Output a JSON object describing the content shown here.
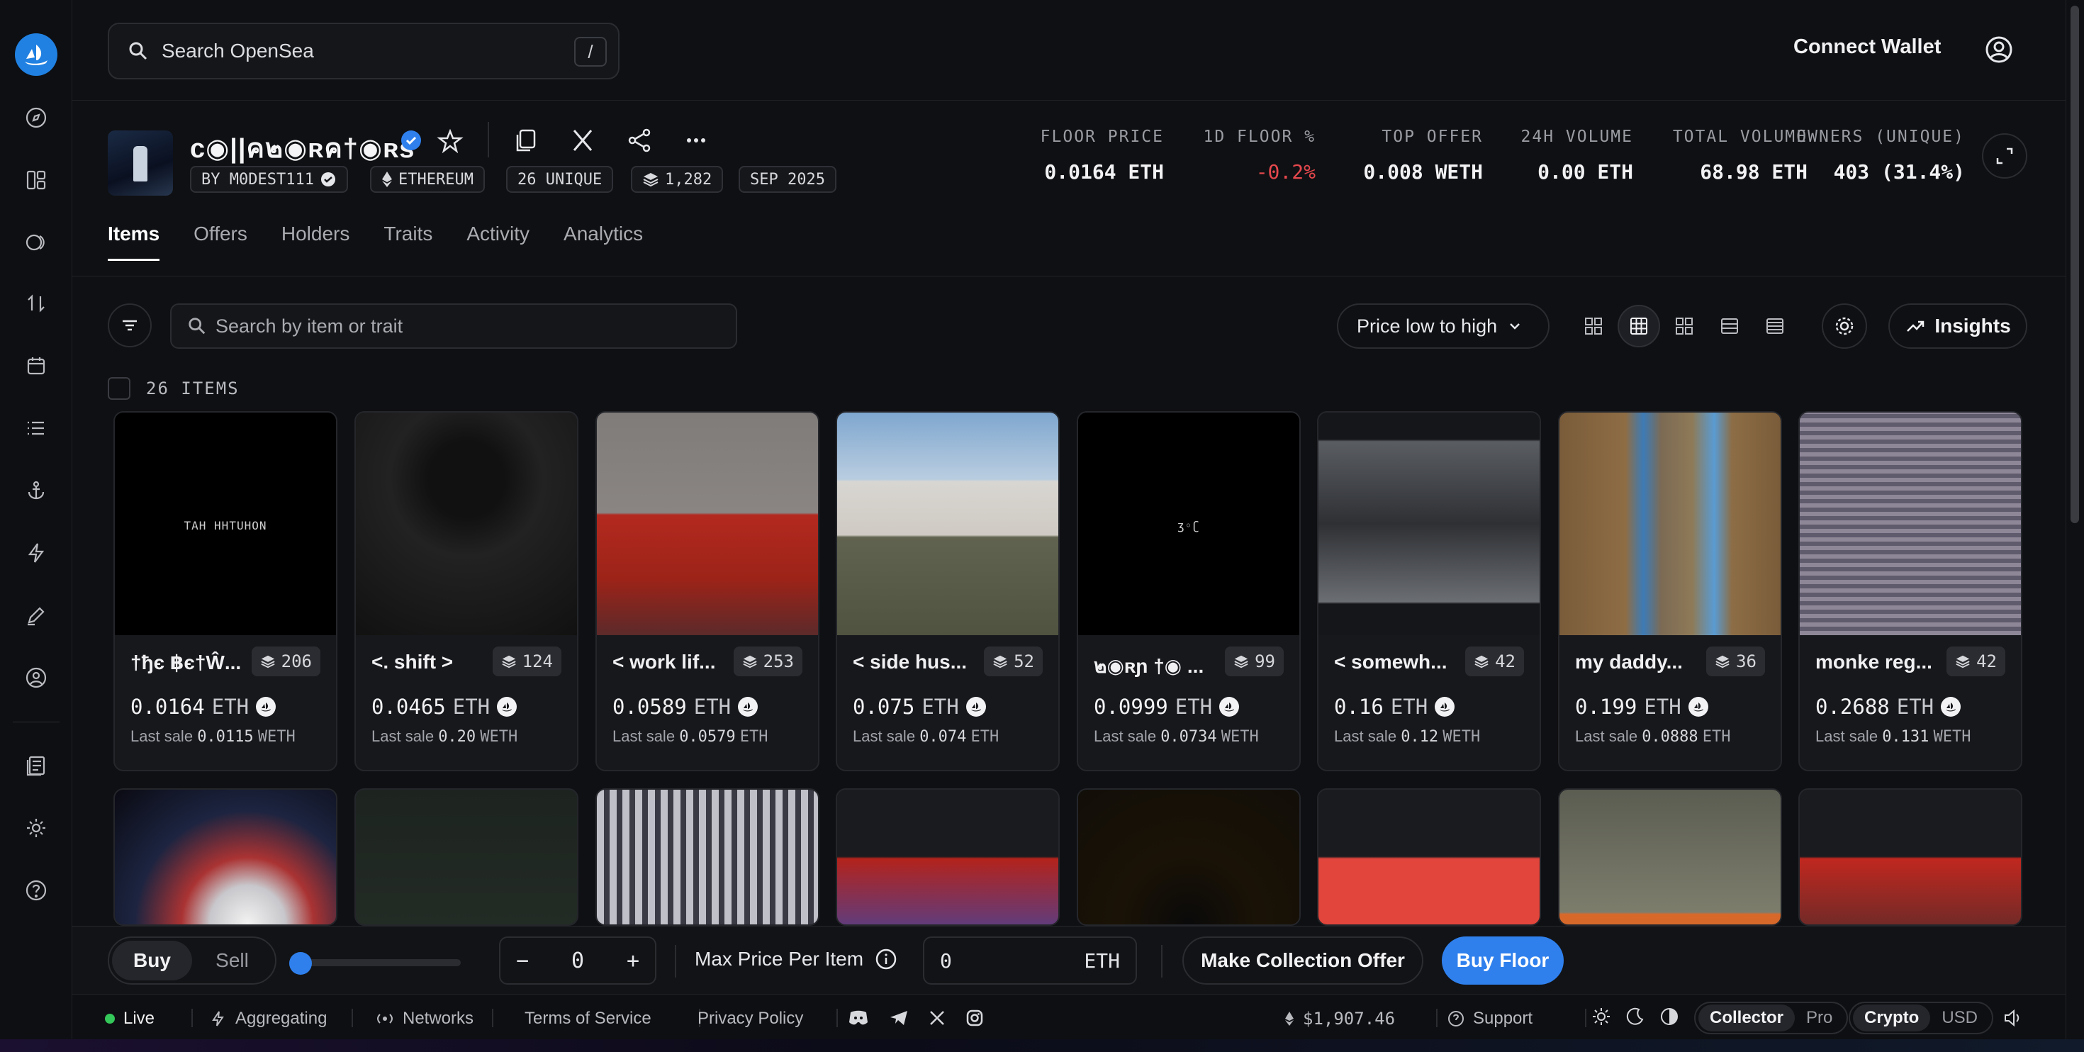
{
  "search": {
    "placeholder": "Search OpenSea",
    "shortcut": "/"
  },
  "header": {
    "connect_wallet": "Connect Wallet"
  },
  "collection": {
    "name": "c◉||ค๒◉ʀค†◉ʀs",
    "creator": "BY M0DEST111",
    "chain": "ETHEREUM",
    "unique": "26 UNIQUE",
    "items_count": "1,282",
    "date": "SEP 2025"
  },
  "stats": [
    {
      "label": "FLOOR PRICE",
      "value": "0.0164 ETH",
      "negative": false
    },
    {
      "label": "1D FLOOR %",
      "value": "-0.2%",
      "negative": true
    },
    {
      "label": "TOP OFFER",
      "value": "0.008 WETH",
      "negative": false
    },
    {
      "label": "24H VOLUME",
      "value": "0.00 ETH",
      "negative": false
    },
    {
      "label": "TOTAL VOLUME",
      "value": "68.98 ETH",
      "negative": false
    },
    {
      "label": "OWNERS (UNIQUE)",
      "value": "403 (31.4%)",
      "negative": false
    }
  ],
  "tabs": [
    "Items",
    "Offers",
    "Holders",
    "Traits",
    "Activity",
    "Analytics"
  ],
  "toolbar": {
    "item_search_placeholder": "Search by item or trait",
    "sort": "Price low to high",
    "insights": "Insights",
    "items_count": "26 ITEMS"
  },
  "cards_row1": [
    {
      "title": "†ђє ฿є†Ŵ...",
      "edition": "206",
      "price": "0.0164",
      "unit": "ETH",
      "last_label": "Last sale",
      "last_value": "0.0115",
      "last_unit": "WETH",
      "img_text": "TAH HHTUHON"
    },
    {
      "title": "<. shift >",
      "edition": "124",
      "price": "0.0465",
      "unit": "ETH",
      "last_label": "Last sale",
      "last_value": "0.20",
      "last_unit": "WETH",
      "img_text": ""
    },
    {
      "title": "< work lif...",
      "edition": "253",
      "price": "0.0589",
      "unit": "ETH",
      "last_label": "Last sale",
      "last_value": "0.0579",
      "last_unit": "ETH",
      "img_text": ""
    },
    {
      "title": "< side hus...",
      "edition": "52",
      "price": "0.075",
      "unit": "ETH",
      "last_label": "Last sale",
      "last_value": "0.074",
      "last_unit": "ETH",
      "img_text": ""
    },
    {
      "title": "๒◉ʀɲ †◉ ...",
      "edition": "99",
      "price": "0.0999",
      "unit": "ETH",
      "last_label": "Last sale",
      "last_value": "0.0734",
      "last_unit": "WETH",
      "img_text": "ʒ◦ʗ"
    },
    {
      "title": "< somewh...",
      "edition": "42",
      "price": "0.16",
      "unit": "ETH",
      "last_label": "Last sale",
      "last_value": "0.12",
      "last_unit": "WETH",
      "img_text": ""
    },
    {
      "title": "my daddy...",
      "edition": "36",
      "price": "0.199",
      "unit": "ETH",
      "last_label": "Last sale",
      "last_value": "0.0888",
      "last_unit": "ETH",
      "img_text": ""
    },
    {
      "title": "monke reg...",
      "edition": "42",
      "price": "0.2688",
      "unit": "ETH",
      "last_label": "Last sale",
      "last_value": "0.131",
      "last_unit": "WETH",
      "img_text": ""
    }
  ],
  "buybar": {
    "buy": "Buy",
    "sell": "Sell",
    "quantity": "0",
    "minus": "−",
    "plus": "+",
    "max_price_label": "Max Price Per Item",
    "max_price_value": "0",
    "max_price_unit": "ETH",
    "make_offer": "Make Collection Offer",
    "buy_floor": "Buy Floor"
  },
  "status": {
    "live": "Live",
    "aggregating": "Aggregating",
    "networks": "Networks",
    "terms": "Terms of Service",
    "privacy": "Privacy Policy",
    "eth_price": "$1,907.46",
    "support": "Support",
    "collector": "Collector",
    "pro": "Pro",
    "crypto": "Crypto",
    "usd": "USD"
  },
  "colors": {
    "accent": "#2f80ed",
    "negative": "#e5484d",
    "live": "#34c759"
  }
}
